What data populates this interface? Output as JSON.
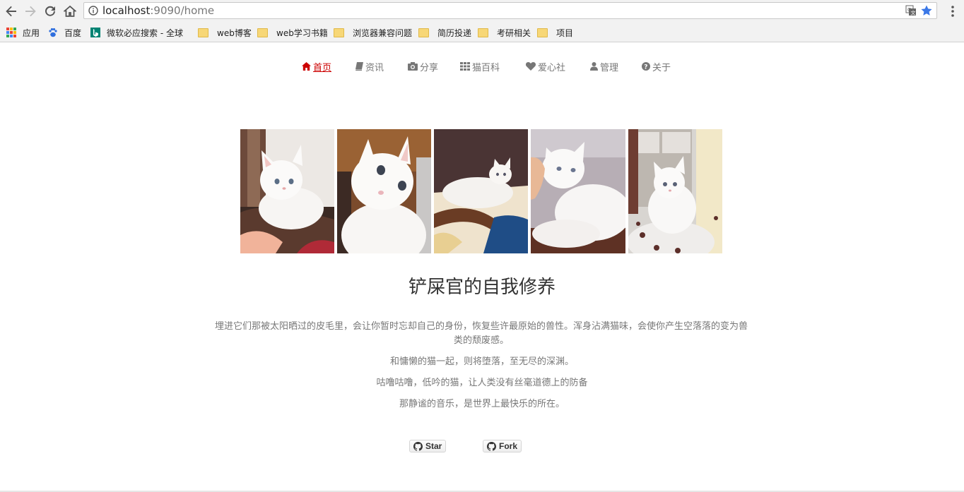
{
  "browser": {
    "url_host": "localhost",
    "url_port_path": ":9090/home",
    "bookmarks": [
      {
        "label": "应用",
        "icon": "apps-grid-icon"
      },
      {
        "label": "百度",
        "icon": "baidu-paw-icon"
      },
      {
        "label": "微软必应搜索 - 全球",
        "icon": "bing-icon"
      },
      {
        "label": "web博客",
        "icon": "folder-icon"
      },
      {
        "label": "web学习书籍",
        "icon": "folder-icon"
      },
      {
        "label": "浏览器兼容问题",
        "icon": "folder-icon"
      },
      {
        "label": "简历投递",
        "icon": "folder-icon"
      },
      {
        "label": "考研相关",
        "icon": "folder-icon"
      },
      {
        "label": "项目",
        "icon": "folder-icon"
      }
    ]
  },
  "nav": {
    "items": [
      {
        "label": "首页",
        "icon": "home-icon",
        "active": true
      },
      {
        "label": "资讯",
        "icon": "book-icon"
      },
      {
        "label": "分享",
        "icon": "camera-icon"
      },
      {
        "label": "猫百科",
        "icon": "grid-icon"
      },
      {
        "label": "爱心社",
        "icon": "heart-icon"
      },
      {
        "label": "管理",
        "icon": "user-icon"
      },
      {
        "label": "关于",
        "icon": "question-circle-icon"
      }
    ],
    "active_color": "#cc0000",
    "text_color": "#777777"
  },
  "gallery": {
    "photos": [
      {
        "name": "cat-photo-1"
      },
      {
        "name": "cat-photo-2"
      },
      {
        "name": "cat-photo-3"
      },
      {
        "name": "cat-photo-4"
      },
      {
        "name": "cat-photo-5"
      }
    ]
  },
  "content": {
    "title": "铲屎官的自我修养",
    "lead": "埋进它们那被太阳晒过的皮毛里，会让你暂时忘却自己的身份，恢复些许最原始的兽性。浑身沾满猫味，会使你产生空落落的变为兽类的颓废感。",
    "line2": "和慵懒的猫一起，则将堕落，至无尽的深渊。",
    "line3": "咕噜咕噜，低吟的猫，让人类没有丝毫道德上的防备",
    "line4": "那静谧的音乐，是世界上最快乐的所在。"
  },
  "github": {
    "star_label": "Star",
    "fork_label": "Fork"
  }
}
